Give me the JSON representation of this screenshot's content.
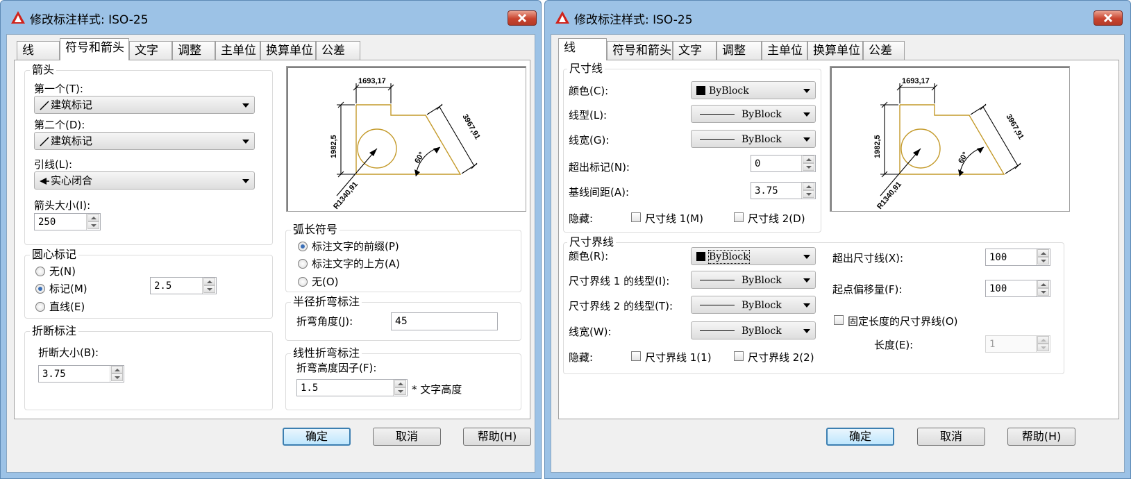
{
  "colors": {
    "frame": "#9cc2e6",
    "accent": "#3c7fb1",
    "drawing": "#c49a2a"
  },
  "left_dialog": {
    "title": "修改标注样式: ISO-25",
    "tabs": [
      "线",
      "符号和箭头",
      "文字",
      "调整",
      "主单位",
      "换算单位",
      "公差"
    ],
    "active_tab": "符号和箭头",
    "arrowheads": {
      "group_label": "箭头",
      "first_label": "第一个(T):",
      "first_value": "建筑标记",
      "second_label": "第二个(D):",
      "second_value": "建筑标记",
      "leader_label": "引线(L):",
      "leader_value": "实心闭合",
      "size_label": "箭头大小(I):",
      "size_value": "250"
    },
    "center_marks": {
      "group_label": "圆心标记",
      "options": [
        "无(N)",
        "标记(M)",
        "直线(E)"
      ],
      "selected": "标记(M)",
      "size_value": "2.5"
    },
    "dim_break": {
      "group_label": "折断标注",
      "size_label": "折断大小(B):",
      "size_value": "3.75"
    },
    "arc_length": {
      "group_label": "弧长符号",
      "options": [
        "标注文字的前缀(P)",
        "标注文字的上方(A)",
        "无(O)"
      ],
      "selected": "标注文字的前缀(P)"
    },
    "radius_jog": {
      "group_label": "半径折弯标注",
      "angle_label": "折弯角度(J):",
      "angle_value": "45"
    },
    "linear_jog": {
      "group_label": "线性折弯标注",
      "factor_label": "折弯高度因子(F):",
      "factor_value": "1.5",
      "suffix": "* 文字高度"
    },
    "buttons": {
      "ok": "确定",
      "cancel": "取消",
      "help": "帮助(H)"
    }
  },
  "right_dialog": {
    "title": "修改标注样式: ISO-25",
    "tabs": [
      "线",
      "符号和箭头",
      "文字",
      "调整",
      "主单位",
      "换算单位",
      "公差"
    ],
    "active_tab": "线",
    "dim_lines": {
      "group_label": "尺寸线",
      "color_label": "颜色(C):",
      "color_value": "ByBlock",
      "linetype_label": "线型(L):",
      "linetype_value": "ByBlock",
      "lineweight_label": "线宽(G):",
      "lineweight_value": "ByBlock",
      "extend_ticks_label": "超出标记(N):",
      "extend_ticks_value": "0",
      "baseline_label": "基线间距(A):",
      "baseline_value": "3.75",
      "suppress_label": "隐藏:",
      "suppress_1": "尺寸线 1(M)",
      "suppress_2": "尺寸线 2(D)"
    },
    "ext_lines": {
      "group_label": "尺寸界线",
      "color_label": "颜色(R):",
      "color_value": "ByBlock",
      "linetype1_label": "尺寸界线 1 的线型(I):",
      "linetype1_value": "ByBlock",
      "linetype2_label": "尺寸界线 2 的线型(T):",
      "linetype2_value": "ByBlock",
      "lineweight_label": "线宽(W):",
      "lineweight_value": "ByBlock",
      "suppress_label": "隐藏:",
      "suppress_1": "尺寸界线 1(1)",
      "suppress_2": "尺寸界线 2(2)",
      "extend_label": "超出尺寸线(X):",
      "extend_value": "100",
      "offset_label": "起点偏移量(F):",
      "offset_value": "100",
      "fixed_label": "固定长度的尺寸界线(O)",
      "length_label": "长度(E):",
      "length_value": "1"
    },
    "buttons": {
      "ok": "确定",
      "cancel": "取消",
      "help": "帮助(H)"
    }
  },
  "preview": {
    "dim_top": "1693,17",
    "dim_left": "1982,5",
    "dim_right": "3967,91",
    "angle": "60°",
    "radius": "R1340,91"
  }
}
